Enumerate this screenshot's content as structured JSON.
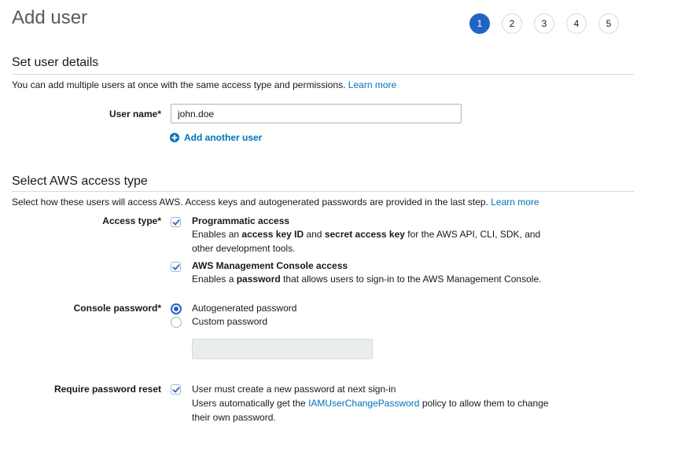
{
  "page": {
    "title": "Add user",
    "steps": [
      "1",
      "2",
      "3",
      "4",
      "5"
    ]
  },
  "details": {
    "heading": "Set user details",
    "description": "You can add multiple users at once with the same access type and permissions.",
    "learn_more": "Learn more",
    "username_label": "User name*",
    "username_value": "john.doe",
    "add_another": "Add another user"
  },
  "access": {
    "heading": "Select AWS access type",
    "description": "Select how these users will access AWS. Access keys and autogenerated passwords are provided in the last step.",
    "learn_more": "Learn more",
    "access_type_label": "Access type*",
    "programmatic": {
      "title": "Programmatic access",
      "desc_1": "Enables an ",
      "desc_b1": "access key ID",
      "desc_2": " and ",
      "desc_b2": "secret access key",
      "desc_3": " for the AWS API, CLI, SDK, and",
      "desc_4": "other development tools.",
      "checked": true
    },
    "console": {
      "title": "AWS Management Console access",
      "desc_1": "Enables a ",
      "desc_b1": "password",
      "desc_2": " that allows users to sign-in to the AWS Management Console.",
      "checked": true
    },
    "password_label": "Console password*",
    "password_options": {
      "auto": "Autogenerated password",
      "custom": "Custom password",
      "selected": "auto"
    },
    "reset_label": "Require password reset",
    "reset": {
      "line1": "User must create a new password at next sign-in",
      "line2_a": "Users automatically get the ",
      "policy_link": "IAMUserChangePassword",
      "line2_b": " policy to allow them to change",
      "line3": "their own password.",
      "checked": true
    }
  },
  "colors": {
    "primary": "#2264c5",
    "link": "#0073bb",
    "border": "#d5dbdb",
    "title_gray": "#545b64"
  }
}
